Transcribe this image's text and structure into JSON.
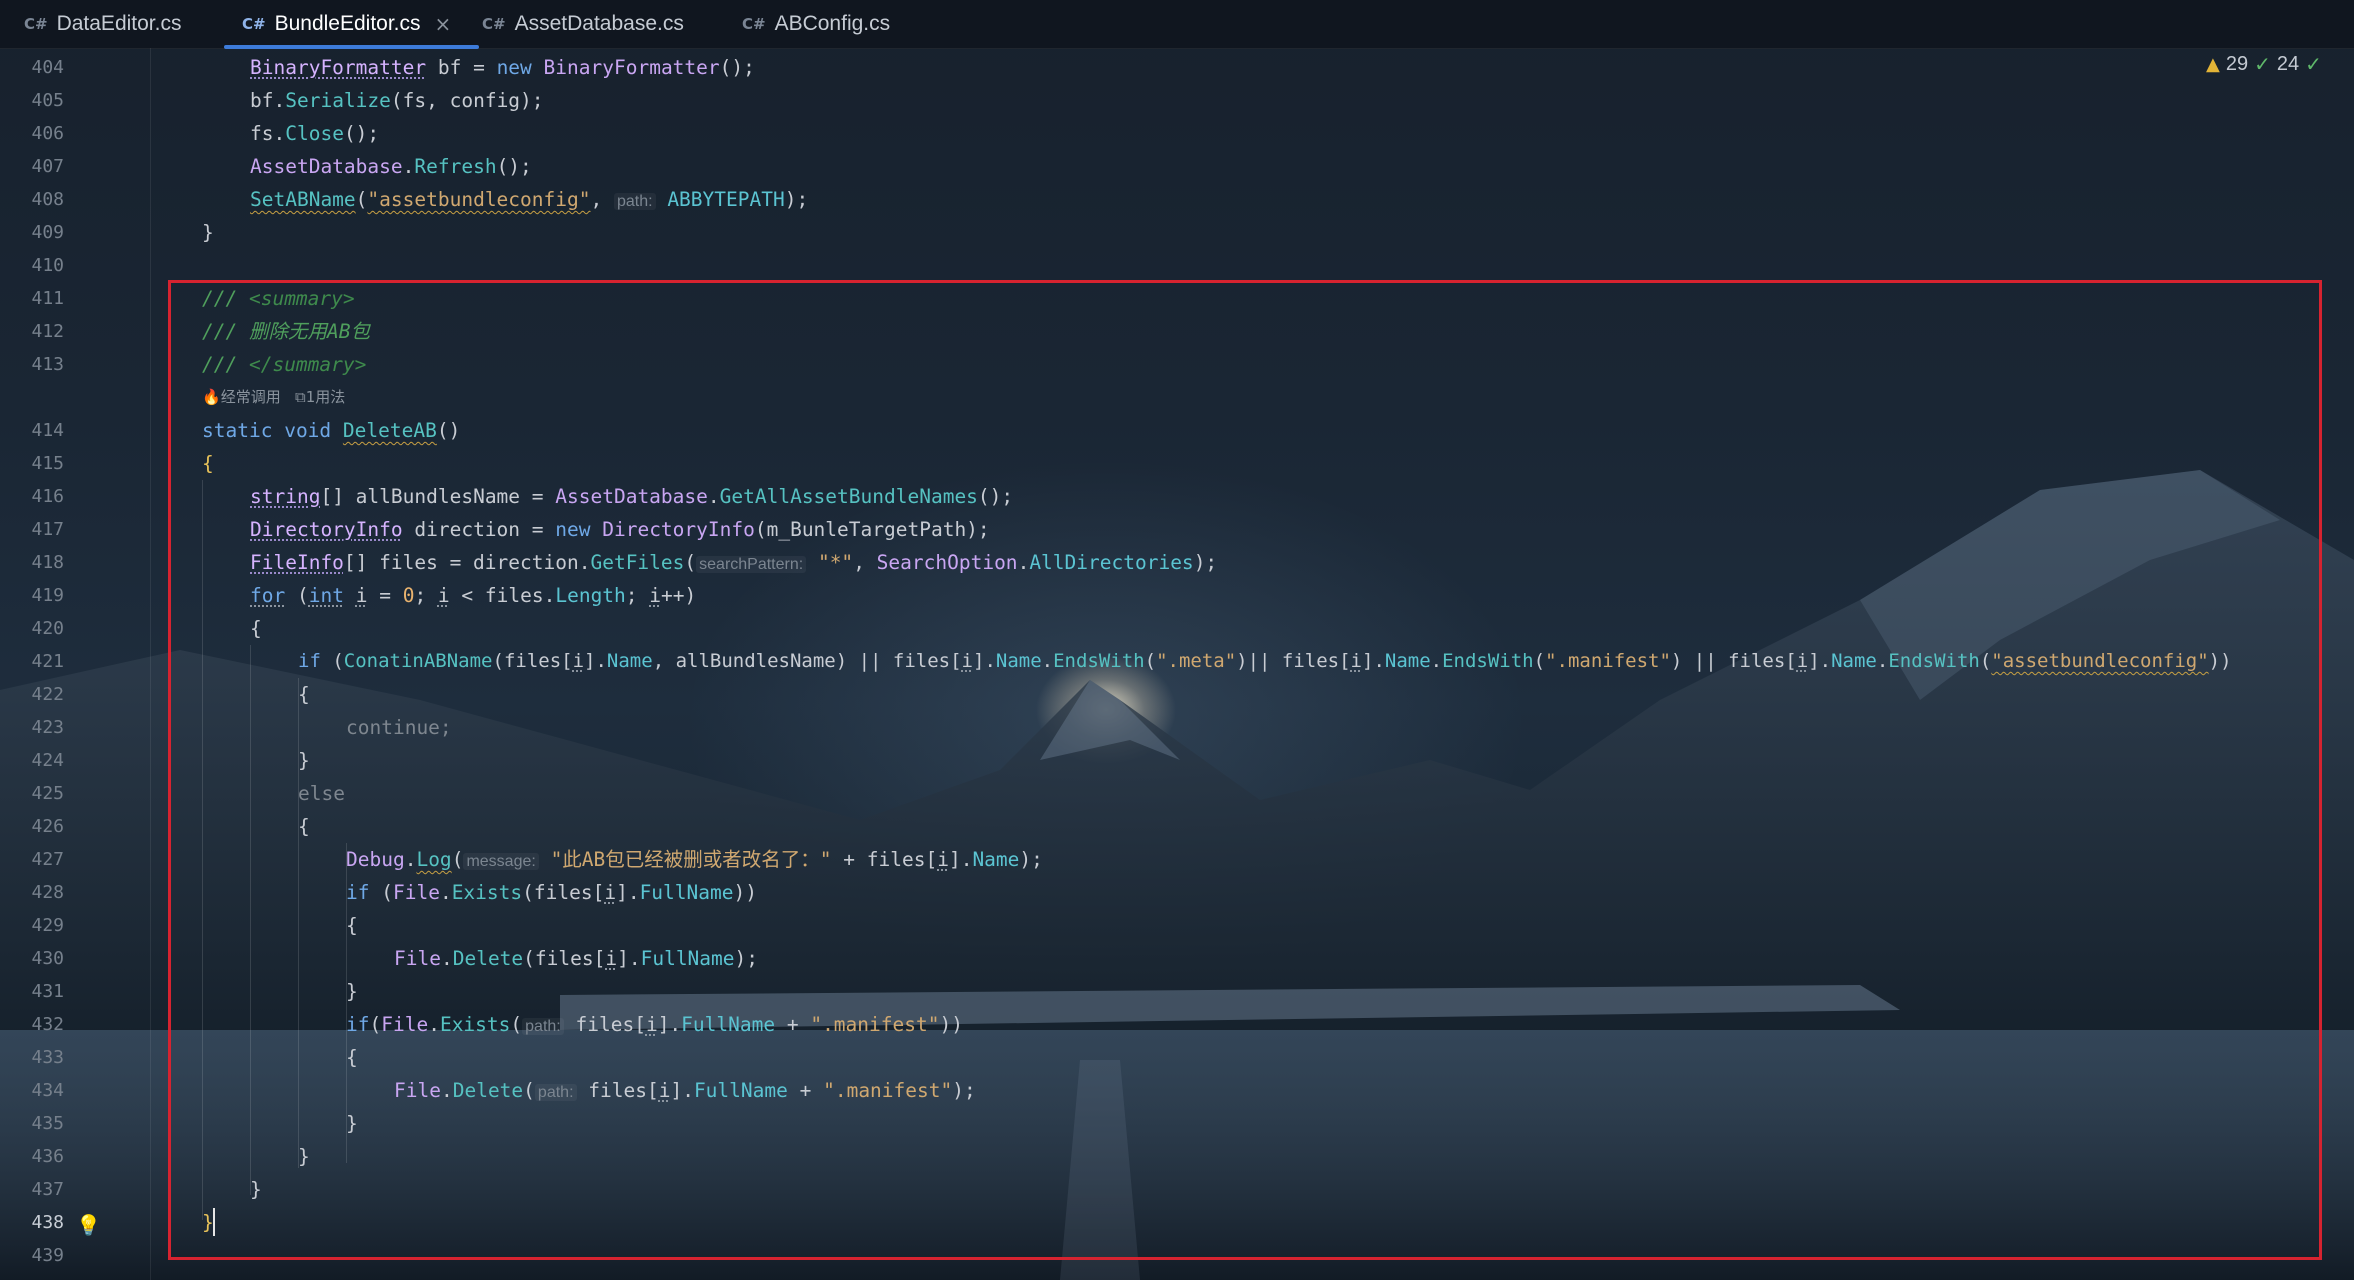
{
  "tabs": [
    {
      "badge": "C#",
      "label": "DataEditor.cs"
    },
    {
      "badge": "C#",
      "label": "BundleEditor.cs",
      "close": "×"
    },
    {
      "badge": "C#",
      "label": "AssetDatabase.cs"
    },
    {
      "badge": "C#",
      "label": "ABConfig.cs"
    }
  ],
  "status": {
    "warnings": "29",
    "checks": "24"
  },
  "line_numbers": [
    "404",
    "405",
    "406",
    "407",
    "408",
    "409",
    "410",
    "411",
    "412",
    "413",
    "414",
    "415",
    "416",
    "417",
    "418",
    "419",
    "420",
    "421",
    "422",
    "423",
    "424",
    "425",
    "426",
    "427",
    "428",
    "429",
    "430",
    "431",
    "432",
    "433",
    "434",
    "435",
    "436",
    "437",
    "438",
    "439"
  ],
  "code_lens": {
    "usage": "经常调用",
    "refs": "1用法"
  },
  "code": {
    "l404": {
      "t1": "BinaryFormatter",
      "t2": " bf = ",
      "t3": "new",
      "t4": " ",
      "t5": "BinaryFormatter",
      "t6": "();"
    },
    "l405": {
      "t1": "bf.",
      "t2": "Serialize",
      "t3": "(fs, config);"
    },
    "l406": {
      "t1": "fs.",
      "t2": "Close",
      "t3": "();"
    },
    "l407": {
      "t1": "AssetDatabase",
      "t2": ".",
      "t3": "Refresh",
      "t4": "();"
    },
    "l408": {
      "t1": "SetABName",
      "t2": "(",
      "t3": "\"assetbundleconfig\"",
      "t4": ", ",
      "hint": "path:",
      "t5": " ",
      "t6": "ABBYTEPATH",
      "t7": ");"
    },
    "l409": {
      "t1": "}"
    },
    "l411": {
      "t1": "/// ",
      "t2": "<summary>"
    },
    "l412": {
      "t1": "/// 删除无用AB包"
    },
    "l413": {
      "t1": "/// ",
      "t2": "</summary>"
    },
    "l414": {
      "t1": "static",
      "t2": " ",
      "t3": "void",
      "t4": " ",
      "t5": "DeleteAB",
      "t6": "()"
    },
    "l415": {
      "t1": "{"
    },
    "l416": {
      "t1": "string",
      "t2": "[] allBundlesName = ",
      "t3": "AssetDatabase",
      "t4": ".",
      "t5": "GetAllAssetBundleNames",
      "t6": "();"
    },
    "l417": {
      "t1": "DirectoryInfo",
      "t2": " direction = ",
      "t3": "new",
      "t4": " ",
      "t5": "DirectoryInfo",
      "t6": "(m_BunleTargetPath);"
    },
    "l418": {
      "t1": "FileInfo",
      "t2": "[] files = direction.",
      "t3": "GetFiles",
      "t4": "(",
      "hint": "searchPattern:",
      "t5": " ",
      "t6": "\"*\"",
      "t7": ", ",
      "t8": "SearchOption",
      "t9": ".",
      "t10": "AllDirectories",
      "t11": ");"
    },
    "l419": {
      "t1": "for",
      "t2": " (",
      "t3": "int",
      "t4": " ",
      "t5": "i",
      "t6": " = ",
      "t7": "0",
      "t8": "; ",
      "t9": "i",
      "t10": " < files.",
      "t11": "Length",
      "t12": "; ",
      "t13": "i",
      "t14": "++)"
    },
    "l420": {
      "t1": "{"
    },
    "l421": {
      "t1": "if",
      "t2": " (",
      "t3": "ConatinABName",
      "t4": "(files[",
      "t5": "i",
      "t6": "].",
      "t7": "Name",
      "t8": ", allBundlesName) || files[",
      "t9": "i",
      "t10": "].",
      "t11": "Name",
      "t12": ".",
      "t13": "EndsWith",
      "t14": "(",
      "t15": "\".meta\"",
      "t16": ")|| files[",
      "t17": "i",
      "t18": "].",
      "t19": "Name",
      "t20": ".",
      "t21": "EndsWith",
      "t22": "(",
      "t23": "\".manifest\"",
      "t24": ") || files[",
      "t25": "i",
      "t26": "].",
      "t27": "Name",
      "t28": ".",
      "t29": "EndsWith",
      "t30": "(",
      "t31": "\"assetbundleconfig\"",
      "t32": "))"
    },
    "l422": {
      "t1": "{"
    },
    "l423": {
      "t1": "continue;"
    },
    "l424": {
      "t1": "}"
    },
    "l425": {
      "t1": "else"
    },
    "l426": {
      "t1": "{"
    },
    "l427": {
      "t1": "Debug",
      "t2": ".",
      "t3": "Log",
      "t4": "(",
      "hint": "message:",
      "t5": " ",
      "t6": "\"此AB包已经被删或者改名了：\"",
      "t7": " + files[",
      "t8": "i",
      "t9": "].",
      "t10": "Name",
      "t11": ");"
    },
    "l428": {
      "t1": "if",
      "t2": " (",
      "t3": "File",
      "t4": ".",
      "t5": "Exists",
      "t6": "(files[",
      "t7": "i",
      "t8": "].",
      "t9": "FullName",
      "t10": "))"
    },
    "l429": {
      "t1": "{"
    },
    "l430": {
      "t1": "File",
      "t2": ".",
      "t3": "Delete",
      "t4": "(files[",
      "t5": "i",
      "t6": "].",
      "t7": "FullName",
      "t8": ");"
    },
    "l431": {
      "t1": "}"
    },
    "l432": {
      "t1": "if",
      "t2": "(",
      "t3": "File",
      "t4": ".",
      "t5": "Exists",
      "t6": "(",
      "hint": "path:",
      "t7": " files[",
      "t8": "i",
      "t9": "].",
      "t10": "FullName",
      "t11": " + ",
      "t12": "\".manifest\"",
      "t13": "))"
    },
    "l433": {
      "t1": "{"
    },
    "l434": {
      "t1": "File",
      "t2": ".",
      "t3": "Delete",
      "t4": "(",
      "hint": "path:",
      "t5": " files[",
      "t6": "i",
      "t7": "].",
      "t8": "FullName",
      "t9": " + ",
      "t10": "\".manifest\"",
      "t11": ");"
    },
    "l435": {
      "t1": "}"
    },
    "l436": {
      "t1": "}"
    },
    "l437": {
      "t1": "}"
    },
    "l438": {
      "t1": "}"
    }
  }
}
